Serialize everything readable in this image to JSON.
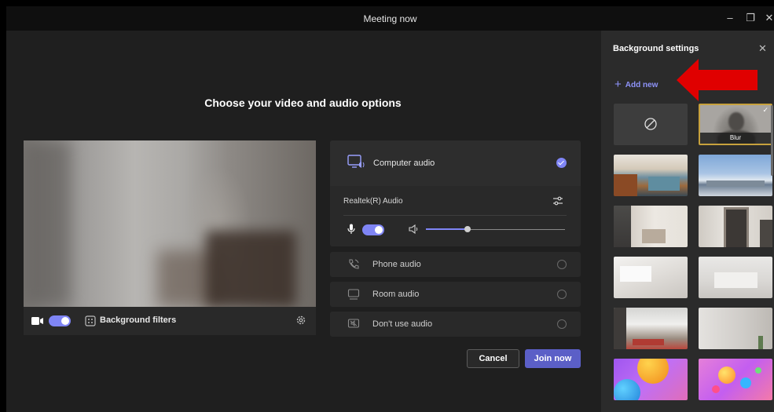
{
  "window": {
    "title": "Meeting now",
    "minimize_glyph": "–",
    "maximize_glyph": "❐",
    "close_glyph": "✕"
  },
  "main": {
    "heading": "Choose your video and audio options"
  },
  "preview": {
    "camera_on": true,
    "background_filters_label": "Background filters"
  },
  "audio": {
    "computer_audio_label": "Computer audio",
    "device_label": "Realtek(R) Audio",
    "mic_on": true,
    "volume_fraction": 0.3,
    "options": [
      {
        "label": "Phone audio",
        "icon": "phone-icon"
      },
      {
        "label": "Room audio",
        "icon": "room-icon"
      },
      {
        "label": "Don't use audio",
        "icon": "no-audio-icon"
      }
    ],
    "cancel_label": "Cancel",
    "join_label": "Join now"
  },
  "background_panel": {
    "title": "Background settings",
    "close_glyph": "✕",
    "add_new_label": "Add new",
    "blur_label": "Blur",
    "selected": "Blur"
  },
  "colors": {
    "accent": "#7f85f5",
    "join_button": "#5b5fc7",
    "selected_border": "#c7a13d",
    "annotation_arrow": "#e00000"
  }
}
